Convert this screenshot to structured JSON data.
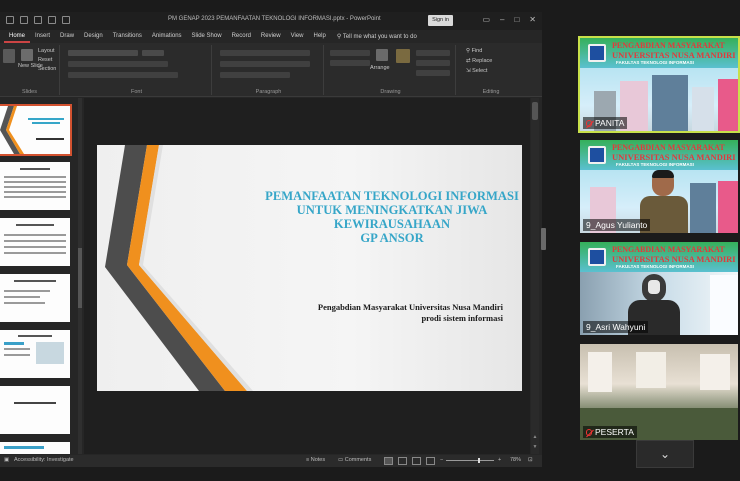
{
  "window": {
    "doc_title": "PM GENAP 2023 PEMANFAATAN TEKNOLOGI INFORMASI.pptx  -  PowerPoint",
    "signin_label": "Sign in"
  },
  "ribbon_tabs": [
    "Home",
    "Insert",
    "Draw",
    "Design",
    "Transitions",
    "Animations",
    "Slide Show",
    "Record",
    "Review",
    "View",
    "Help"
  ],
  "tell_me": "Tell me what you want to do",
  "ribbon": {
    "groups": [
      "Slides",
      "Font",
      "Paragraph",
      "Drawing",
      "Editing"
    ],
    "layout": "Layout",
    "reset": "Reset",
    "section": "Section",
    "new_slide": "New Slide",
    "arrange": "Arrange",
    "find": "Find",
    "replace": "Replace",
    "select": "Select"
  },
  "slide": {
    "title_lines": [
      "PEMANFAATAN TEKNOLOGI INFORMASI",
      "UNTUK MENINGKATKAN JIWA",
      "KEWIRAUSAHAAN",
      "GP ANSOR"
    ],
    "subtitle_lines": [
      "Pengabdian Masyarakat Universitas Nusa Mandiri",
      "prodi sistem informasi"
    ],
    "colors": {
      "title": "#36a6c8",
      "accent_orange": "#f0901e",
      "accent_gray": "#555555"
    }
  },
  "status": {
    "accessibility": "Accessibility: Investigate",
    "notes": "Notes",
    "comments": "Comments",
    "zoom": "78%"
  },
  "participants": [
    {
      "name": "PANITA",
      "muted": true,
      "active": true
    },
    {
      "name": "9_Agus Yulianto",
      "muted": false,
      "active": false
    },
    {
      "name": "9_Asri Wahyuni",
      "muted": false,
      "active": false
    },
    {
      "name": "PESERTA",
      "muted": true,
      "active": false
    }
  ],
  "banner": {
    "line1": "PENGABDIAN MASYARAKAT",
    "line2": "UNIVERSITAS NUSA MANDIRI",
    "line3": "FAKULTAS TEKNOLOGI INFORMASI"
  }
}
